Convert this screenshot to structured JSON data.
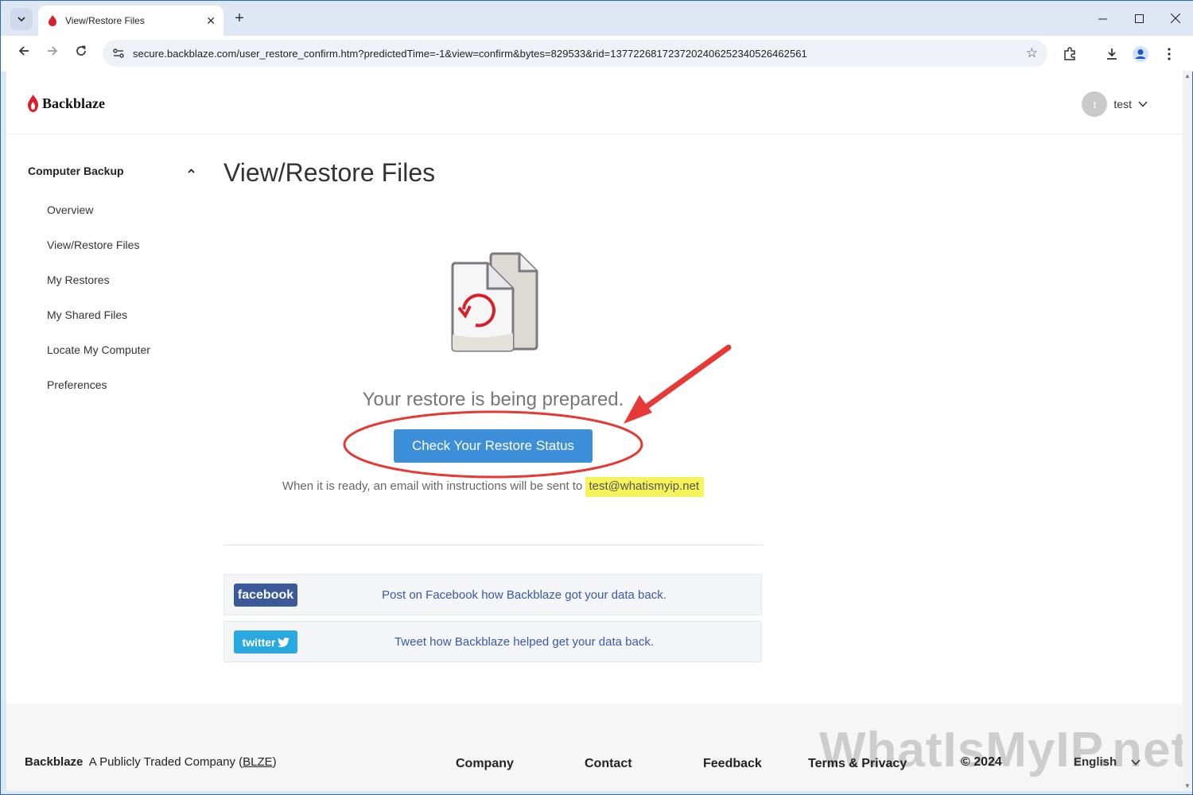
{
  "browser": {
    "tab_title": "View/Restore Files",
    "url": "secure.backblaze.com/user_restore_confirm.htm?predictedTime=-1&view=confirm&bytes=829533&rid=1377226817237202406252340526462561"
  },
  "header": {
    "logo_text": "Backblaze",
    "avatar_initial": "t",
    "user_name": "test"
  },
  "sidebar": {
    "section": "Computer Backup",
    "items": [
      {
        "label": "Overview"
      },
      {
        "label": "View/Restore Files"
      },
      {
        "label": "My Restores"
      },
      {
        "label": "My Shared Files"
      },
      {
        "label": "Locate My Computer"
      },
      {
        "label": "Preferences"
      }
    ]
  },
  "main": {
    "title": "View/Restore Files",
    "prep_text": "Your restore is being prepared.",
    "status_button": "Check Your Restore Status",
    "email_text": "When it is ready, an email with instructions will be sent to",
    "email": "test@whatismyip.net",
    "share": [
      {
        "badge": "facebook",
        "text": "Post on Facebook how Backblaze got your data back.",
        "color": "#3b5998"
      },
      {
        "badge": "twitter",
        "text": "Tweet how Backblaze helped get your data back.",
        "color": "#1da1f2"
      }
    ]
  },
  "footer": {
    "brand": "Backblaze",
    "tagline_prefix": "A Publicly Traded Company (",
    "ticker": "BLZE",
    "tagline_suffix": ")",
    "links": [
      "Company",
      "Contact",
      "Feedback",
      "Terms & Privacy",
      "© 2024"
    ],
    "language": "English",
    "watermark": "WhatIsMyIP.net"
  },
  "colors": {
    "accent": "#3d8fd9",
    "brand_red": "#d8202a",
    "annotation": "#e53935",
    "highlight": "#f6f35a"
  }
}
